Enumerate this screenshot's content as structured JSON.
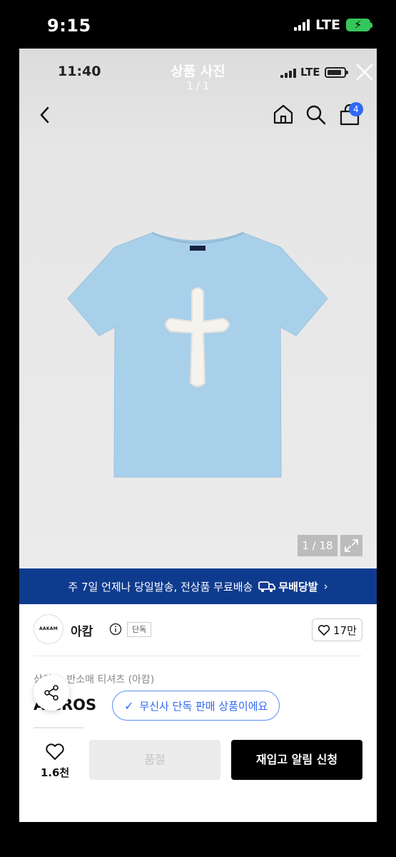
{
  "outer_status": {
    "time": "9:15",
    "network": "LTE"
  },
  "inner_status": {
    "time": "11:40",
    "network": "LTE"
  },
  "viewer": {
    "title": "상품 사진",
    "count": "1 / 1"
  },
  "nav": {
    "cart_badge": "4"
  },
  "photo": {
    "counter": "1 / 18"
  },
  "banner": {
    "text": "주 7일 언제나 당일발송, 전상품 무료배송",
    "logo_text": "무배당발",
    "chevron": "›"
  },
  "brand": {
    "logo_text": "AAKAM",
    "name": "아캄",
    "tag": "단독",
    "like_count": "17만"
  },
  "product": {
    "breadcrumb": "상의 > 반소매 티셔츠 (아캄)",
    "title": "A  CROS",
    "exclusive_label": "무신사 단독 판매 상품이에요"
  },
  "bottom": {
    "wish_count": "1.6천",
    "soldout_label": "품절",
    "restock_label": "재입고 알림 신청"
  },
  "colors": {
    "banner_bg": "#0f3b8f",
    "accent": "#2f68f4",
    "shirt": "#a9d0ea"
  },
  "icons": [
    "back-arrow-icon",
    "home-icon",
    "search-icon",
    "cart-icon",
    "close-icon",
    "expand-icon",
    "truck-icon",
    "info-icon",
    "heart-icon",
    "share-icon",
    "check-icon"
  ]
}
